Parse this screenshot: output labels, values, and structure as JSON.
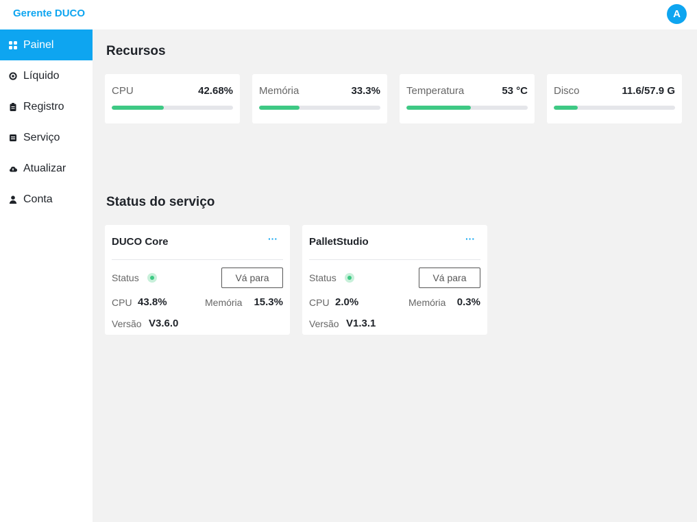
{
  "header": {
    "brand": "Gerente DUCO",
    "avatar_initial": "A"
  },
  "sidebar": {
    "items": [
      {
        "label": "Painel",
        "icon": "grid-icon",
        "active": true
      },
      {
        "label": "Líquido",
        "icon": "circle-dot-icon",
        "active": false
      },
      {
        "label": "Registro",
        "icon": "clipboard-icon",
        "active": false
      },
      {
        "label": "Serviço",
        "icon": "list-box-icon",
        "active": false
      },
      {
        "label": "Atualizar",
        "icon": "cloud-icon",
        "active": false
      },
      {
        "label": "Conta",
        "icon": "user-icon",
        "active": false
      }
    ]
  },
  "resources": {
    "title": "Recursos",
    "items": [
      {
        "label": "CPU",
        "value": "42.68%",
        "progress": 0.4268
      },
      {
        "label": "Memória",
        "value": "33.3%",
        "progress": 0.333
      },
      {
        "label": "Temperatura",
        "value": "53 °C",
        "progress": 0.53
      },
      {
        "label": "Disco",
        "value": "11.6/57.9 G",
        "progress": 0.2
      }
    ]
  },
  "services": {
    "title": "Status do serviço",
    "labels": {
      "status": "Status",
      "cpu": "CPU",
      "memory": "Memória",
      "version": "Versão",
      "go": "Vá para",
      "more": "···"
    },
    "items": [
      {
        "name": "DUCO Core",
        "cpu": "43.8%",
        "memory": "15.3%",
        "version": "V3.6.0",
        "status": "running"
      },
      {
        "name": "PalletStudio",
        "cpu": "2.0%",
        "memory": "0.3%",
        "version": "V1.3.1",
        "status": "running"
      }
    ]
  },
  "colors": {
    "accent": "#0ea5f0",
    "progress": "#3ec984",
    "status_ok": "#3ec984",
    "background": "#f2f2f2"
  }
}
